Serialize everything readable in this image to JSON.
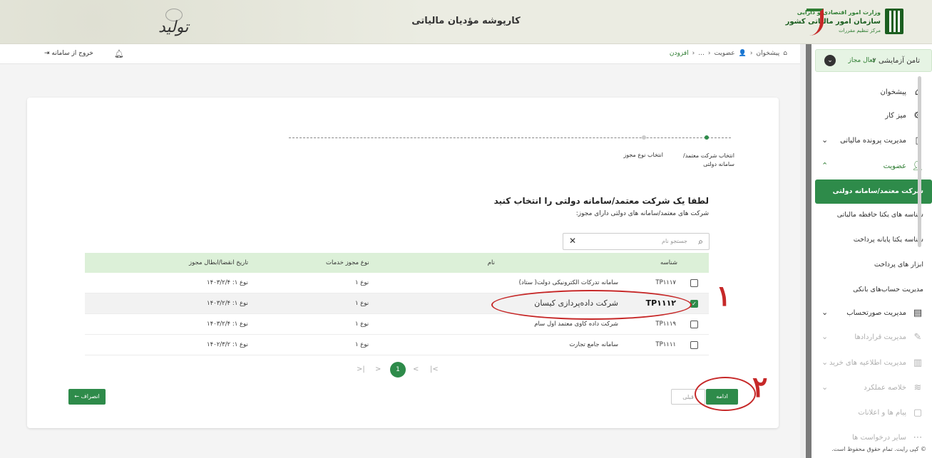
{
  "header": {
    "title": "کارپوشه مؤدیان مالیاتی",
    "logo_line1": "وزارت امور اقتصادی و دارایی",
    "logo_line2": "سازمان امور مالیاتی کشور",
    "logo_line3": "مرکز تنظیم مقررات",
    "calligraphy": "تولید"
  },
  "topbar": {
    "breadcrumb": [
      "پیشخوان",
      "عضویت",
      "...",
      "افزودن"
    ],
    "exit_label": "خروج از سامانه"
  },
  "sidebar": {
    "user_name": "تامن آزمایشی ۲",
    "user_role": "فعال مجاز",
    "items": [
      {
        "label": "پیشخوان",
        "icon": "home-icon"
      },
      {
        "label": "میز کار",
        "icon": "workspace-icon"
      },
      {
        "label": "مدیریت پرونده مالیاتی",
        "icon": "file-icon"
      },
      {
        "label": "عضویت",
        "icon": "user-icon"
      },
      {
        "label": "مدیریت صورتحساب",
        "icon": "invoice-icon"
      },
      {
        "label": "مدیریت قراردادها",
        "icon": "contract-icon"
      },
      {
        "label": "مدیریت اطلاعیه های خرید",
        "icon": "purchase-icon"
      },
      {
        "label": "خلاصه عملکرد",
        "icon": "summary-icon"
      },
      {
        "label": "پیام ها و اعلانات",
        "icon": "message-icon"
      },
      {
        "label": "سایر درخواست ها",
        "icon": "request-icon"
      }
    ],
    "subitems": [
      "شرکت معتمد/سامانه دولتی",
      "شناسه های یکتا حافظه مالیاتی",
      "شناسه یکتا پایانه پرداخت",
      "ابزار های پرداخت",
      "مدیریت حساب‌های بانکی"
    ],
    "footer": "© کپی رایت. تمام حقوق محفوظ است."
  },
  "wizard": {
    "step1": "انتخاب شرکت معتمد/ سامانه دولتی",
    "step2": "انتخاب نوع مجوز"
  },
  "content": {
    "title": "لطفا یک شرکت معتمد/سامانه دولتی را انتخاب کنید",
    "subtitle": "شرکت های معتمد/سامانه های دولتی دارای مجوز:",
    "search_placeholder": "جستجو نام"
  },
  "table": {
    "headers": {
      "id": "شناسه",
      "name": "نام",
      "type": "نوع مجوز خدمات",
      "date": "تاریخ انقضا/ابطال مجوز"
    },
    "rows": [
      {
        "id": "TP۱۱۱۷",
        "name": "سامانه تدرکات الکترونیکی دولت( ستاد)",
        "type": "نوع ۱",
        "date": "نوع ۱: ۱۴۰۳/۲/۴",
        "checked": false
      },
      {
        "id": "TP۱۱۱۲",
        "name": "شرکت داده‌پردازی کیسان",
        "type": "نوع ۱",
        "date": "نوع ۱: ۱۴۰۳/۲/۴",
        "checked": true
      },
      {
        "id": "TP۱۱۱۹",
        "name": "شرکت داده کاوی معتمد اول سام",
        "type": "نوع ۱",
        "date": "نوع ۱: ۱۴۰۳/۲/۴",
        "checked": false
      },
      {
        "id": "TP۱۱۱۱",
        "name": "سامانه جامع تجارت",
        "type": "نوع ۱",
        "date": "نوع ۱: ۱۴۰۲/۳/۲",
        "checked": false
      }
    ]
  },
  "pagination": {
    "current": "1",
    "first": "|<",
    "prev": "<",
    "next": ">",
    "last": ">|"
  },
  "buttons": {
    "cancel": "انصراف ←",
    "prev": "قبلی",
    "next": "ادامه"
  },
  "annotations": {
    "one": "۱",
    "two": "۲"
  },
  "colors": {
    "primary": "#2e8b4a",
    "annotation": "#c62828",
    "table_header": "#dcf0d8"
  }
}
